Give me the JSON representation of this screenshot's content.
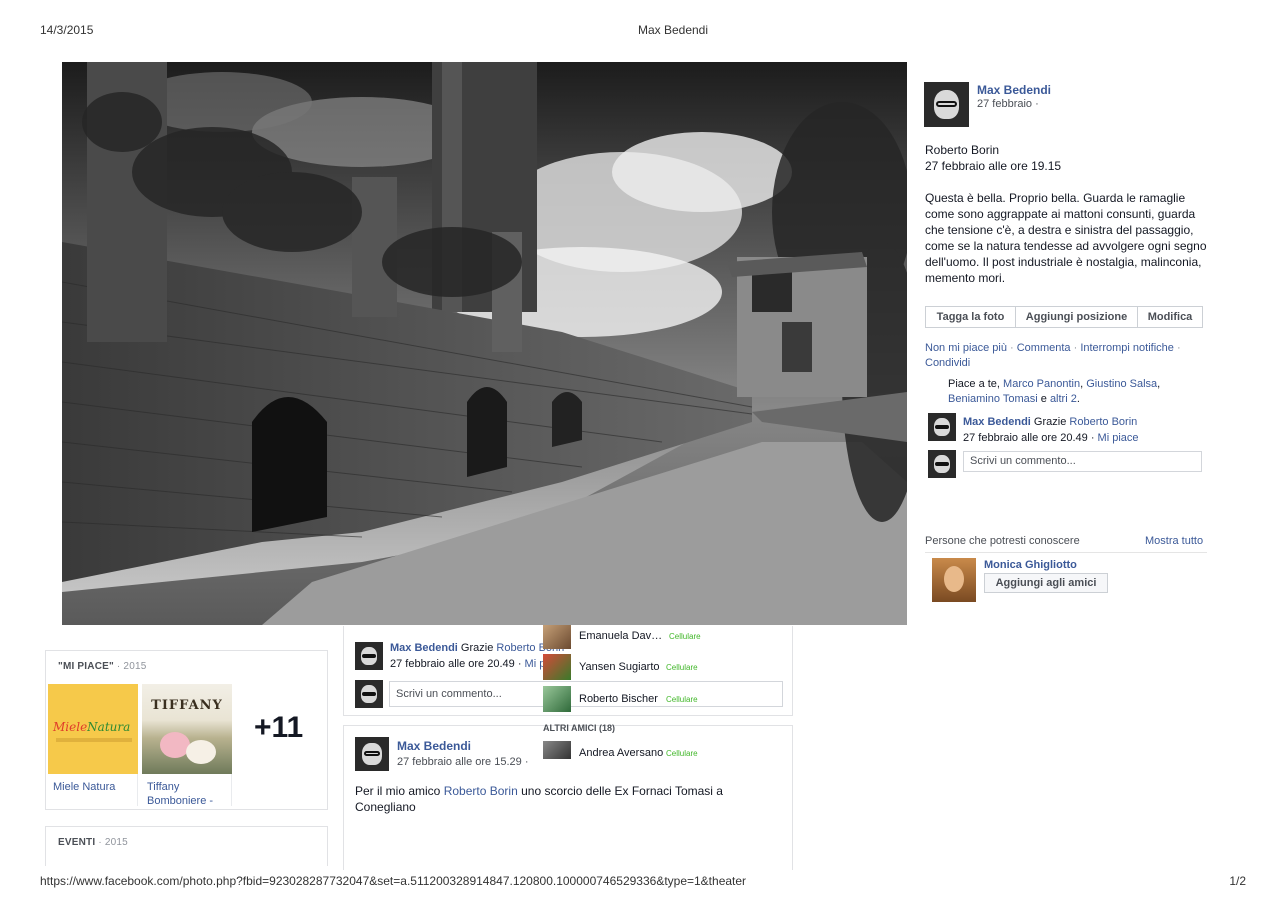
{
  "print": {
    "date": "14/3/2015",
    "title": "Max Bedendi",
    "url": "https://www.facebook.com/photo.php?fbid=923028287732047&set=a.511200328914847.120800.100000746529336&type=1&theater",
    "page": "1/2"
  },
  "theater": {
    "owner_name": "Max Bedendi",
    "owner_date": "27 febbraio ·",
    "post_author": "Roberto Borin",
    "post_time": "27 febbraio alle ore 19.15",
    "post_text": "Questa è bella. Proprio bella. Guarda le ramaglie come sono aggrappate ai mattoni consunti, guarda che tensione c'è, a destra e sinistra del passaggio, come se la natura tendesse ad avvolgere ogni segno dell'uomo. Il post industriale è nostalgia, malinconia, memento mori.",
    "buttons": {
      "tag": "Tagga la foto",
      "location": "Aggiungi posizione",
      "edit": "Modifica"
    },
    "actions": {
      "unlike": "Non mi piace più",
      "comment": "Commenta",
      "stop_notifications": "Interrompi notifiche",
      "share": "Condividi",
      "sep": "·"
    },
    "likes": {
      "prefix": "Piace a te,",
      "names": [
        "Marco Panontin",
        "Giustino Salsa",
        "Beniamino Tomasi"
      ],
      "conj": "e",
      "others": "altri 2",
      "comma": ",",
      "dot": "."
    },
    "reply": {
      "author": "Max Bedendi",
      "text": "Grazie",
      "mention": "Roberto Borin",
      "time": "27 febbraio alle ore 20.49 ·",
      "like": "Mi piace"
    },
    "comment_placeholder": "Scrivi un commento...",
    "pymk": {
      "title": "Persone che potresti conoscere",
      "show_all": "Mostra tutto",
      "person": "Monica Ghigliotto",
      "add": "Aggiungi agli amici"
    }
  },
  "background": {
    "likes_section": {
      "title": "\"MI PIACE\"",
      "year": "· 2015",
      "items": [
        {
          "name": "Miele Natura",
          "logo": [
            "Miele",
            "Natura"
          ]
        },
        {
          "name": "Tiffany Bomboniere -",
          "logo": "TIFFANY"
        }
      ],
      "more": "+11"
    },
    "events_section": {
      "title": "EVENTI",
      "year": "· 2015"
    },
    "comment1": {
      "author": "Max Bedendi",
      "text": "Grazie",
      "mention": "Roberto Borin",
      "time": "27 febbraio alle ore 20.49 ·",
      "like": "Mi pi"
    },
    "comment_placeholder": "Scrivi un commento...",
    "post2": {
      "author": "Max Bedendi",
      "time": "27 febbraio alle ore 15.29 ·",
      "text_before": "Per il mio amico",
      "mention": "Roberto Borin",
      "text_after": "uno scorcio delle Ex Fornaci Tomasi a Conegliano"
    },
    "chat": {
      "friends": [
        {
          "name": "Emanuela Dav…",
          "status": "Cellulare"
        },
        {
          "name": "Yansen Sugiarto",
          "status": "Cellulare"
        },
        {
          "name": "Roberto Bischer",
          "status": "Cellulare"
        }
      ],
      "other_head": "ALTRI AMICI (18)",
      "other": [
        {
          "name": "Andrea Aversano",
          "status": "Cellulare"
        }
      ]
    }
  }
}
